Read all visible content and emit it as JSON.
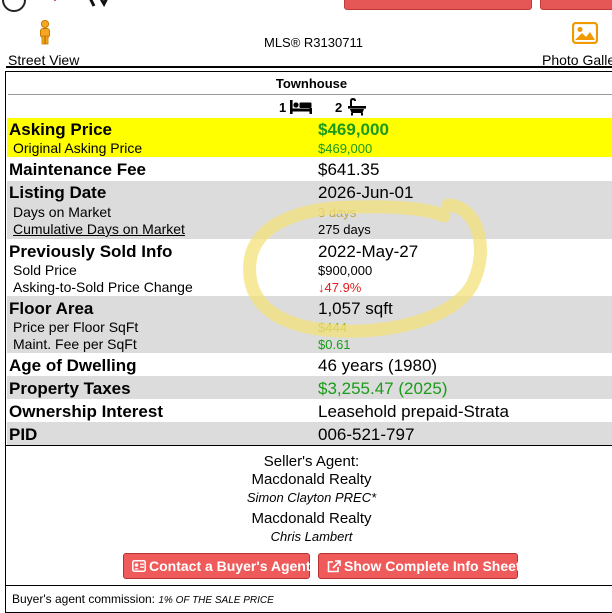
{
  "nav": {
    "street_view_label": "Street View",
    "mls_number": "MLS® R3130711",
    "photo_gallery_label": "Photo Gallery"
  },
  "listing": {
    "property_type": "Townhouse",
    "bedrooms": "1",
    "bathrooms": "2",
    "asking_price": {
      "label": "Asking Price",
      "value": "$469,000"
    },
    "original_asking_price": {
      "label": "Original Asking Price",
      "value": "$469,000"
    },
    "maintenance_fee": {
      "label": "Maintenance Fee",
      "value": "$641.35"
    },
    "listing_date": {
      "label": "Listing Date",
      "value": "2026-Jun-01"
    },
    "days_on_market": {
      "label": "Days on Market",
      "value": "3 days"
    },
    "cumulative_days_on_market": {
      "label": "Cumulative Days on Market",
      "value": "275 days"
    },
    "previously_sold_info": {
      "label": "Previously Sold Info",
      "value": "2022-May-27"
    },
    "sold_price": {
      "label": "Sold Price",
      "value": "$900,000"
    },
    "asking_to_sold_change": {
      "label": "Asking-to-Sold Price Change",
      "value": "47.9%",
      "arrow": "↓"
    },
    "floor_area": {
      "label": "Floor Area",
      "value": "1,057 sqft"
    },
    "price_per_sqft": {
      "label": "Price per Floor SqFt",
      "value": "$444"
    },
    "maint_fee_per_sqft": {
      "label": "Maint. Fee per SqFt",
      "value": "$0.61"
    },
    "age_of_dwelling": {
      "label": "Age of Dwelling",
      "value": "46 years (1980)"
    },
    "property_taxes": {
      "label": "Property Taxes",
      "value": "$3,255.47 (2025)"
    },
    "ownership_interest": {
      "label": "Ownership Interest",
      "value": "Leasehold prepaid-Strata"
    },
    "pid": {
      "label": "PID",
      "value": "006-521-797"
    }
  },
  "agents": {
    "header": "Seller's Agent:",
    "brokerage_1": "Macdonald Realty",
    "agent_1": "Simon Clayton PREC*",
    "brokerage_2": "Macdonald Realty",
    "agent_2": "Chris Lambert"
  },
  "actions": {
    "contact_buyers_agent": "Contact a Buyer's Agent",
    "show_complete_info": "Show Complete Info Sheet"
  },
  "commission": {
    "label": "Buyer's agent commission:",
    "value": "1% OF THE SALE PRICE"
  },
  "icons": {
    "street_view": "pegman-icon",
    "photo_gallery": "photo-gallery-icon",
    "bed": "bed-icon",
    "bath": "bathtub-icon",
    "contact": "contact-card-icon",
    "external": "external-link-icon"
  },
  "colors": {
    "highlight_yellow": "#ffff00",
    "row_gray": "#dcdcdc",
    "value_green": "#1a9b1a",
    "value_red": "#e02020",
    "button_red": "#ef5b5b",
    "scribble_yellow": "#f3e27a"
  }
}
